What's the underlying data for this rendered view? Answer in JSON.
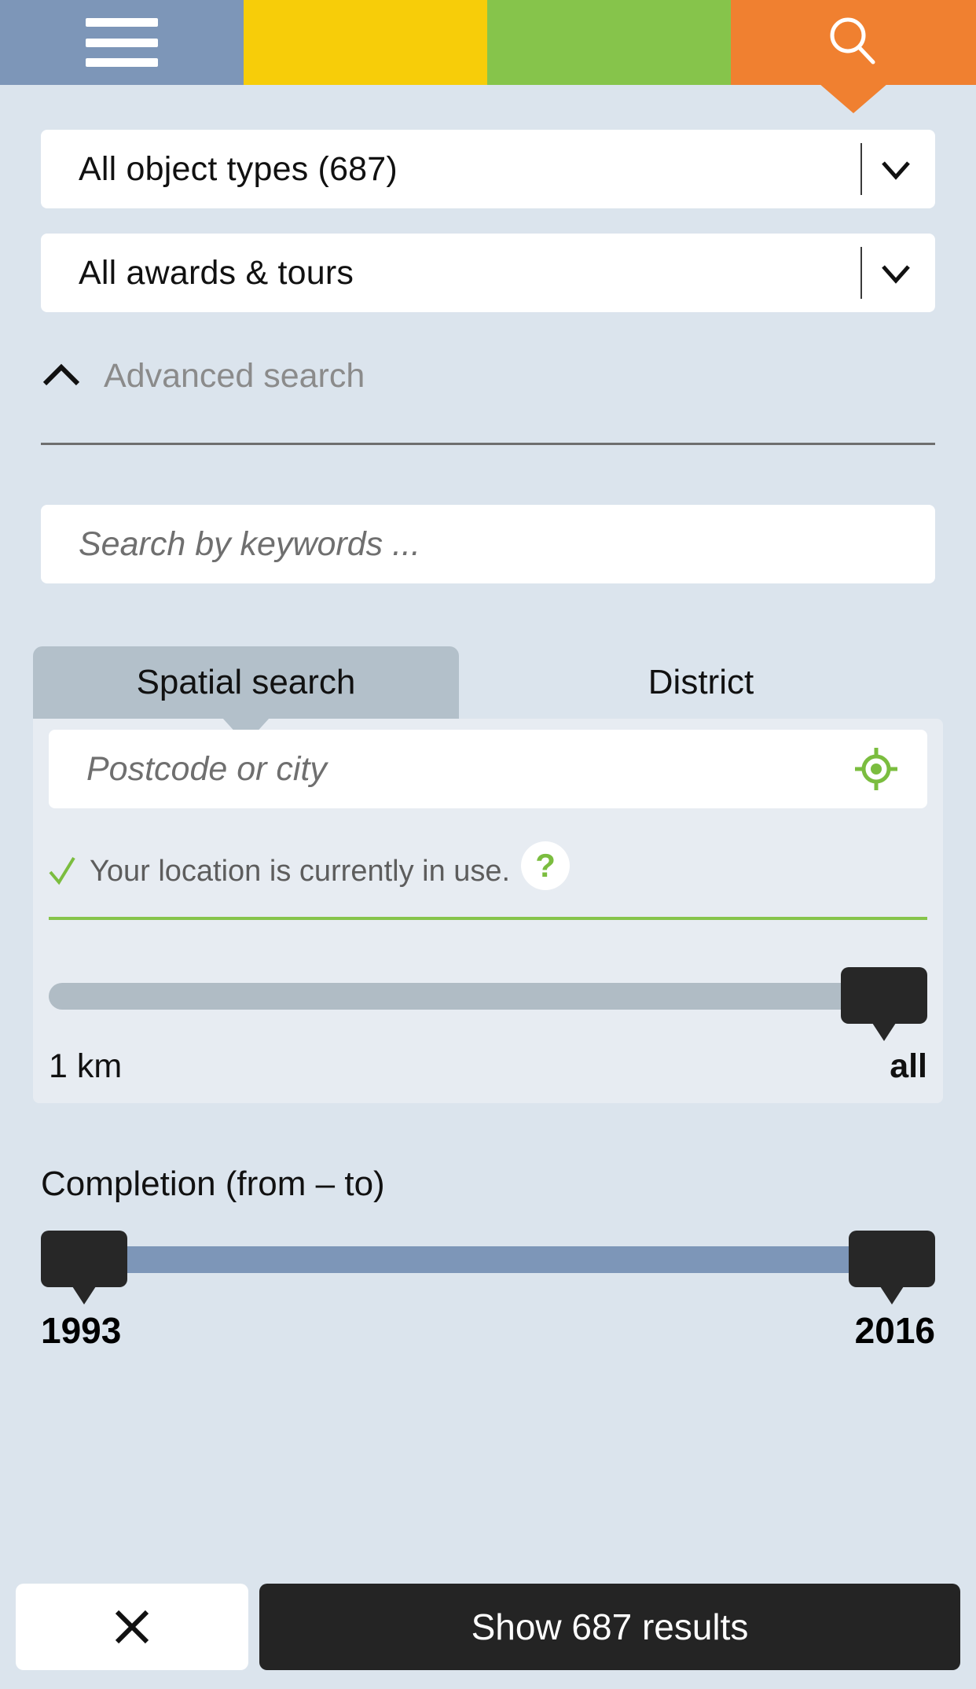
{
  "topbar": {
    "segments": [
      {
        "name": "menu",
        "icon": "hamburger-icon",
        "color": "#7d96b8"
      },
      {
        "name": "segment-yellow",
        "icon": "",
        "color": "#f7cd09"
      },
      {
        "name": "segment-green",
        "icon": "",
        "color": "#86c44b"
      },
      {
        "name": "search",
        "icon": "search-icon",
        "color": "#f08030"
      }
    ]
  },
  "filters": {
    "object_types": {
      "value": "All object types (687)",
      "icon": "chevron-down-icon"
    },
    "awards_tours": {
      "value": "All awards & tours",
      "icon": "chevron-down-icon"
    },
    "advanced_search": {
      "label": "Advanced search",
      "icon": "chevron-up-icon",
      "expanded": true
    },
    "keywords": {
      "value": "",
      "placeholder": "Search by keywords ..."
    }
  },
  "tabs": [
    {
      "label": "Spatial search",
      "active": true
    },
    {
      "label": "District",
      "active": false
    }
  ],
  "spatial": {
    "postcode": {
      "value": "",
      "placeholder": "Postcode or city",
      "icon": "gps-crosshair-icon"
    },
    "location_status": {
      "icon": "check-icon",
      "text": "Your location is currently in use.",
      "help": "?"
    },
    "distance_slider": {
      "min_label": "1 km",
      "max_label": "all",
      "value_percent": 100
    }
  },
  "completion": {
    "title": "Completion (from – to)",
    "from_label": "1993",
    "to_label": "2016",
    "from_percent": 0,
    "to_percent": 100
  },
  "actions": {
    "close_icon": "close-icon",
    "show_results": "Show 687 results"
  },
  "colors": {
    "page_background": "#dbe4ed",
    "panel_background": "#e7ecf2",
    "accent_blue": "#7d96b8",
    "accent_yellow": "#f7cd09",
    "accent_green": "#86c44b",
    "accent_orange": "#f08030",
    "handle_dark": "#272727",
    "tab_active": "#b3c0ca"
  }
}
